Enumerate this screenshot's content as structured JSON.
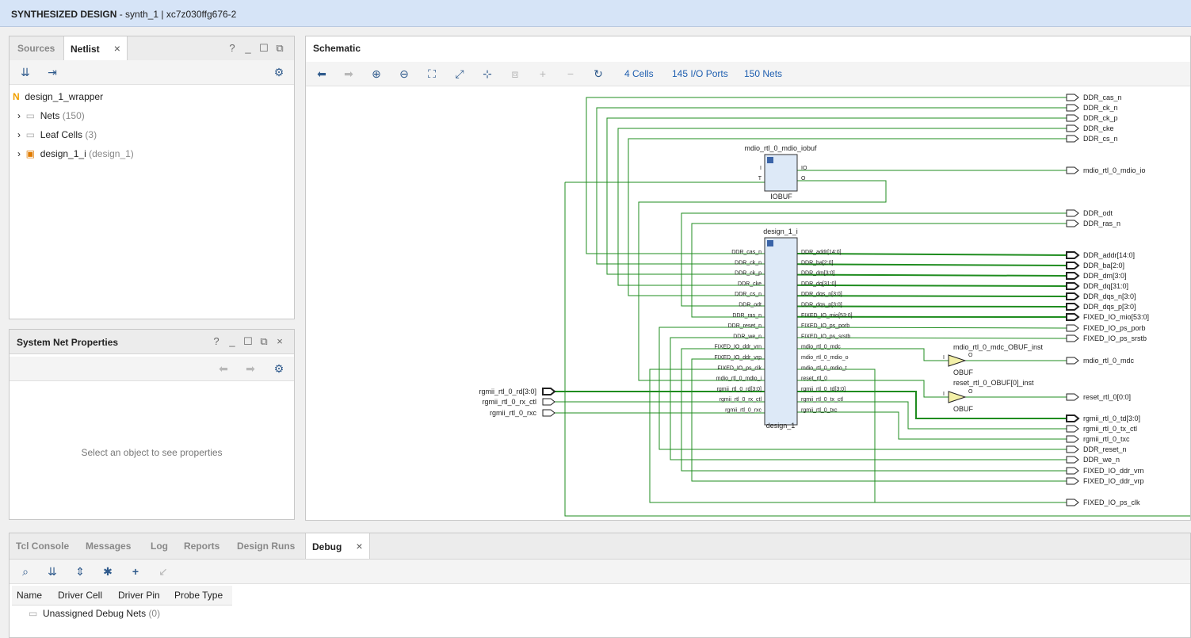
{
  "titlebar": {
    "bold": "SYNTHESIZED DESIGN",
    "rest": " - synth_1 | xc7z030ffg676-2"
  },
  "netlist_panel": {
    "tabs": [
      "Sources",
      "Netlist"
    ],
    "root": "design_1_wrapper",
    "items": [
      {
        "label": "Nets",
        "extra": "(150)"
      },
      {
        "label": "Leaf Cells",
        "extra": "(3)"
      },
      {
        "label": "design_1_i",
        "extra": "(design_1)"
      }
    ]
  },
  "props_panel": {
    "title": "System Net Properties",
    "empty_text": "Select an object to see properties"
  },
  "schematic": {
    "title": "Schematic",
    "stats": [
      "4 Cells",
      "145 I/O Ports",
      "150 Nets"
    ],
    "iobuf": {
      "name": "mdio_rtl_0_mdio_iobuf",
      "type": "IOBUF",
      "pins_left": [
        "I",
        "T"
      ],
      "pins_right": [
        "IO",
        "O"
      ]
    },
    "design": {
      "name_top": "design_1_i",
      "name_bottom": "design_1",
      "pins_left": [
        "DDR_cas_n",
        "DDR_ck_n",
        "DDR_ck_p",
        "DDR_cke",
        "DDR_cs_n",
        "DDR_odt",
        "DDR_ras_n",
        "DDR_reset_n",
        "DDR_we_n",
        "FIXED_IO_ddr_vrn",
        "FIXED_IO_ddr_vrp",
        "FIXED_IO_ps_clk",
        "mdio_rtl_0_mdio_i",
        "rgmii_rtl_0_rd[3:0]",
        "rgmii_rtl_0_rx_ctl",
        "rgmii_rtl_0_rxc"
      ],
      "pins_right": [
        "DDR_addr[14:0]",
        "DDR_ba[2:0]",
        "DDR_dm[3:0]",
        "DDR_dq[31:0]",
        "DDR_dqs_n[3:0]",
        "DDR_dqs_p[3:0]",
        "FIXED_IO_mio[53:0]",
        "FIXED_IO_ps_porb",
        "FIXED_IO_ps_srstb",
        "mdio_rtl_0_mdc",
        "mdio_rtl_0_mdio_o",
        "mdio_rtl_0_mdio_t",
        "reset_rtl_0",
        "rgmii_rtl_0_td[3:0]",
        "rgmii_rtl_0_tx_ctl",
        "rgmii_rtl_0_txc"
      ]
    },
    "obuf1": {
      "name": "mdio_rtl_0_mdc_OBUF_inst",
      "type": "OBUF",
      "pin_i": "I",
      "pin_o": "O"
    },
    "obuf2": {
      "name": "reset_rtl_0_OBUF[0]_inst",
      "type": "OBUF",
      "pin_i": "I",
      "pin_o": "O"
    },
    "input_ports": [
      "rgmii_rtl_0_rd[3:0]",
      "rgmii_rtl_0_rx_ctl",
      "rgmii_rtl_0_rxc"
    ],
    "output_ports": [
      "DDR_cas_n",
      "DDR_ck_n",
      "DDR_ck_p",
      "DDR_cke",
      "DDR_cs_n",
      "mdio_rtl_0_mdio_io",
      "DDR_odt",
      "DDR_ras_n",
      "DDR_addr[14:0]",
      "DDR_ba[2:0]",
      "DDR_dm[3:0]",
      "DDR_dq[31:0]",
      "DDR_dqs_n[3:0]",
      "DDR_dqs_p[3:0]",
      "FIXED_IO_mio[53:0]",
      "FIXED_IO_ps_porb",
      "FIXED_IO_ps_srstb",
      "mdio_rtl_0_mdc",
      "reset_rtl_0[0:0]",
      "rgmii_rtl_0_td[3:0]",
      "rgmii_rtl_0_tx_ctl",
      "rgmii_rtl_0_txc",
      "DDR_reset_n",
      "DDR_we_n",
      "FIXED_IO_ddr_vrn",
      "FIXED_IO_ddr_vrp",
      "FIXED_IO_ps_clk"
    ],
    "colors": {
      "wire": "#1f8c1f",
      "block_fill": "#dde9f7",
      "block_stroke": "#333333",
      "buffer_fill": "#f3f0a8"
    }
  },
  "bottom_panel": {
    "tabs": [
      "Tcl Console",
      "Messages",
      "Log",
      "Reports",
      "Design Runs",
      "Debug"
    ],
    "columns": [
      "Name",
      "Driver Cell",
      "Driver Pin",
      "Probe Type"
    ],
    "row_label": "Unassigned Debug Nets",
    "row_extra": "(0)"
  }
}
